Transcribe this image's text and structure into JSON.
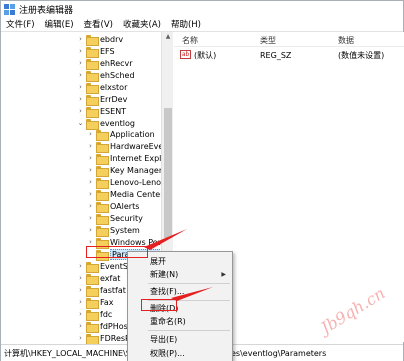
{
  "window": {
    "title": "注册表编辑器"
  },
  "menubar": {
    "items": [
      "文件(F)",
      "编辑(E)",
      "查看(V)",
      "收藏夹(A)",
      "帮助(H)"
    ]
  },
  "tree": {
    "items": [
      {
        "label": "ebdrv",
        "expanded": false
      },
      {
        "label": "EFS",
        "expanded": false
      },
      {
        "label": "ehRecvr",
        "expanded": false
      },
      {
        "label": "ehSched",
        "expanded": false
      },
      {
        "label": "elxstor",
        "expanded": false
      },
      {
        "label": "ErrDev",
        "expanded": false
      },
      {
        "label": "ESENT",
        "expanded": false
      },
      {
        "label": "eventlog",
        "expanded": true
      },
      {
        "label": "Application",
        "expanded": false
      },
      {
        "label": "HardwareEvents",
        "expanded": false
      },
      {
        "label": "Internet Explorer",
        "expanded": false
      },
      {
        "label": "Key Management",
        "expanded": false
      },
      {
        "label": "Lenovo-Lenovo",
        "expanded": false
      },
      {
        "label": "Media Center",
        "expanded": false
      },
      {
        "label": "OAlerts",
        "expanded": false
      },
      {
        "label": "Security",
        "expanded": false
      },
      {
        "label": "System",
        "expanded": false
      },
      {
        "label": "Windows Pow",
        "expanded": false
      },
      {
        "label": "Parameters",
        "expanded": false,
        "selected": true
      },
      {
        "label": "EventSyst",
        "expanded": false
      },
      {
        "label": "exfat",
        "expanded": false
      },
      {
        "label": "fastfat",
        "expanded": false
      },
      {
        "label": "Fax",
        "expanded": false
      },
      {
        "label": "fdc",
        "expanded": false
      },
      {
        "label": "fdPHost",
        "expanded": false
      },
      {
        "label": "FDResPub",
        "expanded": false
      }
    ]
  },
  "list": {
    "columns": [
      "名称",
      "类型",
      "数据"
    ],
    "rows": [
      {
        "name": "(默认)",
        "type": "REG_SZ",
        "data": "(数值未设置)",
        "icon": "string-value-icon"
      }
    ]
  },
  "context_menu": {
    "items": [
      {
        "label": "展开",
        "submenu": false
      },
      {
        "label": "新建(N)",
        "submenu": true
      },
      {
        "label": "查找(F)...",
        "submenu": false
      },
      {
        "label": "删除(D)",
        "submenu": false,
        "highlighted": true
      },
      {
        "label": "重命名(R)",
        "submenu": false
      },
      {
        "label": "导出(E)",
        "submenu": false
      },
      {
        "label": "权限(P)...",
        "submenu": false
      }
    ]
  },
  "statusbar": {
    "path_left": "计算机\\HKEY_LOCAL_MACHINE\\SY",
    "path_right": "es\\eventlog\\Parameters"
  },
  "watermark": {
    "text": "Jb9qh.cn"
  },
  "colors": {
    "annotation": "#e52020",
    "selection": "#cde8ff",
    "folder": "#f4cf5b"
  }
}
